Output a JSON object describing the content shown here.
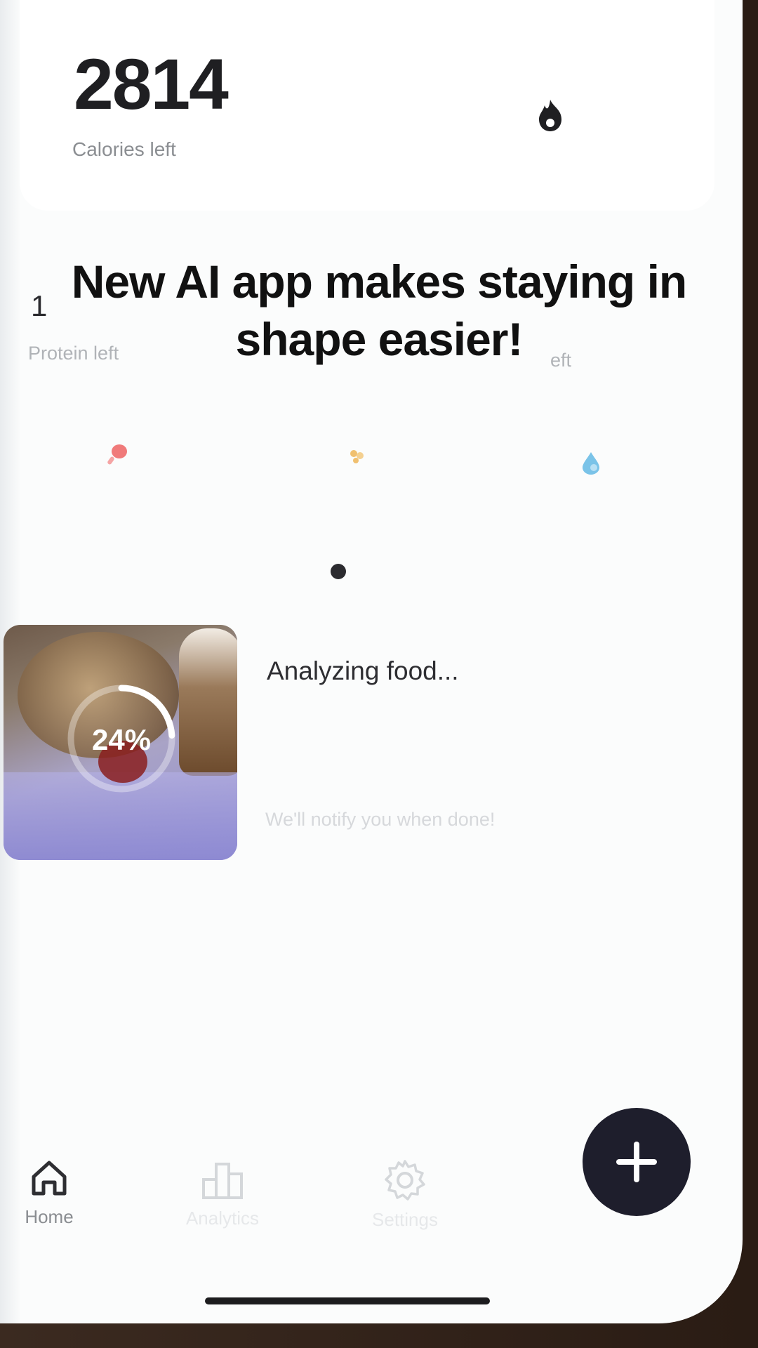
{
  "calories": {
    "value": "2814",
    "label": "Calories left",
    "icon": "flame-icon"
  },
  "macros": [
    {
      "number": "1",
      "label": "Protein left",
      "icon": "drumstick-icon",
      "color": "#f07a7a"
    },
    {
      "number": "",
      "label": "",
      "icon": "wheat-icon",
      "color": "#f0c070"
    },
    {
      "number": "",
      "label": "eft",
      "icon": "droplet-icon",
      "color": "#7ac3e8"
    }
  ],
  "caption": "New AI app makes staying in shape easier!",
  "analysis": {
    "title": "Analyzing food...",
    "subtitle": "We'll notify you when done!",
    "progress_text": "24%",
    "progress_fraction": 0.24
  },
  "nav": {
    "items": [
      {
        "label": "Home",
        "icon": "home-icon",
        "active": true
      },
      {
        "label": "Analytics",
        "icon": "analytics-icon",
        "active": false
      },
      {
        "label": "Settings",
        "icon": "gear-icon",
        "active": false
      }
    ],
    "add_button_icon": "plus-icon"
  },
  "colors": {
    "dark": "#1e1e2c",
    "accent_active": "#2e2e32",
    "inactive": "#c4c7cb"
  }
}
